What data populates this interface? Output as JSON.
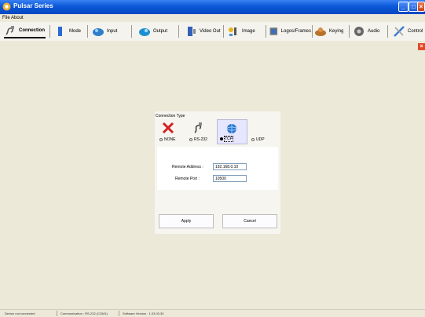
{
  "window": {
    "title": "Pulsar Series"
  },
  "menu": {
    "file": "File",
    "about": "About"
  },
  "toolbar": {
    "items": [
      {
        "label": "Connection",
        "icon": "connection-icon"
      },
      {
        "label": "Mode",
        "icon": "mode-icon"
      },
      {
        "label": "Input",
        "icon": "input-icon"
      },
      {
        "label": "Output",
        "icon": "output-icon"
      },
      {
        "label": "Video Out",
        "icon": "video-out-icon"
      },
      {
        "label": "Image",
        "icon": "image-icon"
      },
      {
        "label": "Logos/Frames",
        "icon": "logos-frames-icon"
      },
      {
        "label": "Keying",
        "icon": "keying-icon"
      },
      {
        "label": "Audio",
        "icon": "audio-icon"
      },
      {
        "label": "Control",
        "icon": "control-icon"
      }
    ],
    "active": "Connection"
  },
  "connection": {
    "group_title": "Connection Type",
    "options": [
      {
        "label": "NONE",
        "icon": "none-x-icon"
      },
      {
        "label": "RS-232",
        "icon": "rs232-icon"
      },
      {
        "label": "TCP",
        "icon": "tcp-icon"
      },
      {
        "label": "UDP",
        "icon": "udp-icon"
      }
    ],
    "selected": "TCP",
    "remote_address_label": "Remote Address :",
    "remote_address_value": "192.168.0.10",
    "remote_port_label": "Remote Port :",
    "remote_port_value": "10500",
    "apply_label": "Apply",
    "cancel_label": "Cancel"
  },
  "status": {
    "device": "Device not connected",
    "communication": "Communication : RS-232 (COM1)",
    "software": "Software Version : 1.03.00.30"
  },
  "colors": {
    "titlebar": "#0a58d8",
    "background": "#ece9d8",
    "tcp_highlight": "#e6e6ff"
  }
}
